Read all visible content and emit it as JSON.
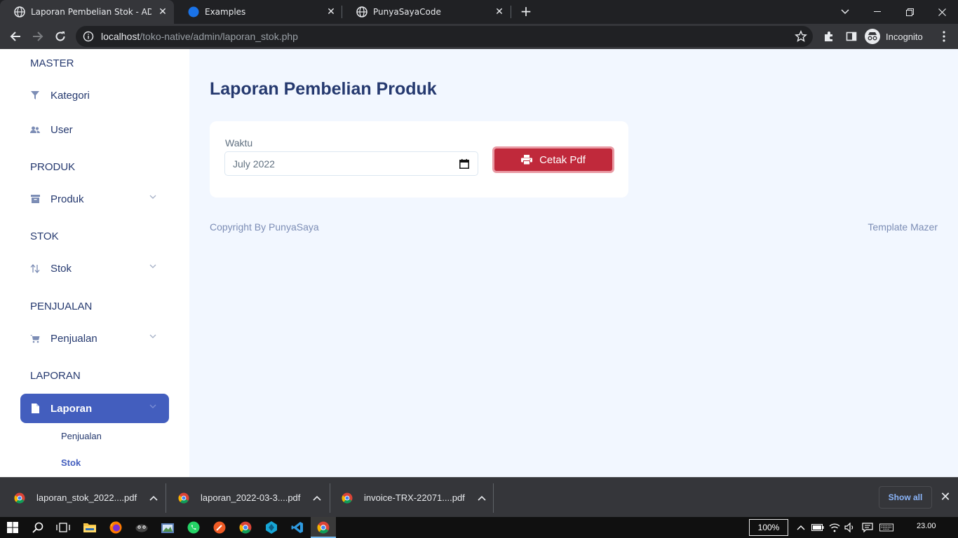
{
  "browser": {
    "tabs": [
      {
        "title": "Laporan Pembelian Stok - ADMIN",
        "active": true
      },
      {
        "title": "Examples",
        "active": false
      },
      {
        "title": "PunyaSayaCode",
        "active": false
      }
    ],
    "url_host": "localhost",
    "url_path": "/toko-native/admin/laporan_stok.php",
    "profile_label": "Incognito"
  },
  "sidebar": {
    "sections": [
      {
        "label": "MASTER"
      },
      {
        "label": "PRODUK"
      },
      {
        "label": "STOK"
      },
      {
        "label": "PENJUALAN"
      },
      {
        "label": "LAPORAN"
      }
    ],
    "items": [
      {
        "label": "Kategori",
        "icon": "filter-icon"
      },
      {
        "label": "User",
        "icon": "users-icon"
      },
      {
        "label": "Produk",
        "icon": "archive-icon",
        "has_submenu": true
      },
      {
        "label": "Stok",
        "icon": "sort-arrows-icon",
        "has_submenu": true
      },
      {
        "label": "Penjualan",
        "icon": "cart-icon",
        "has_submenu": true
      },
      {
        "label": "Laporan",
        "icon": "file-icon",
        "has_submenu": true,
        "active": true
      }
    ],
    "submenu": [
      {
        "label": "Penjualan"
      },
      {
        "label": "Stok",
        "current": true
      }
    ]
  },
  "main": {
    "title": "Laporan Pembelian Produk",
    "form": {
      "label": "Waktu",
      "value": "July 2022",
      "button_label": "Cetak Pdf"
    },
    "footer": {
      "left": "Copyright By PunyaSaya",
      "right": "Template Mazer"
    }
  },
  "downloads": {
    "items": [
      {
        "name": "laporan_stok_2022....pdf"
      },
      {
        "name": "laporan_2022-03-3....pdf"
      },
      {
        "name": "invoice-TRX-22071....pdf"
      }
    ],
    "show_all_label": "Show all"
  },
  "taskbar": {
    "zoom": "100%",
    "time": "23.00"
  },
  "colors": {
    "primary": "#435ebe",
    "danger": "#c0293b",
    "text_dark": "#25396f",
    "page_bg": "#f2f7ff"
  }
}
